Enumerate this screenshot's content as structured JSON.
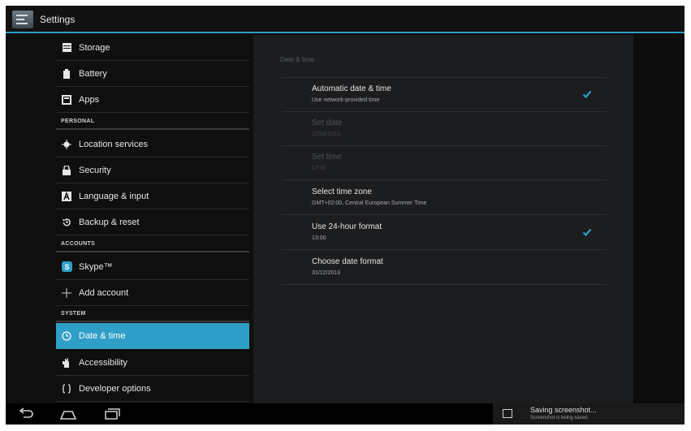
{
  "action_bar": {
    "title": "Settings",
    "icon": "settings-icon"
  },
  "sidebar": {
    "items_top": [
      {
        "label": "Storage",
        "icon": "storage-icon"
      },
      {
        "label": "Battery",
        "icon": "battery-icon"
      },
      {
        "label": "Apps",
        "icon": "apps-icon"
      }
    ],
    "personal_header": "PERSONAL",
    "personal": [
      {
        "label": "Location services",
        "icon": "location-icon"
      },
      {
        "label": "Security",
        "icon": "lock-icon"
      },
      {
        "label": "Language & input",
        "icon": "language-icon"
      },
      {
        "label": "Backup & reset",
        "icon": "backup-icon"
      }
    ],
    "accounts_header": "ACCOUNTS",
    "accounts": [
      {
        "label": "Skype™",
        "icon": "skype-icon"
      },
      {
        "label": "Add account",
        "icon": "plus-icon"
      }
    ],
    "system_header": "SYSTEM",
    "system": [
      {
        "label": "Date & time",
        "icon": "clock-icon",
        "selected": true
      },
      {
        "label": "Accessibility",
        "icon": "accessibility-icon"
      },
      {
        "label": "Developer options",
        "icon": "braces-icon"
      }
    ]
  },
  "panel": {
    "title": "Date & time",
    "rows": [
      {
        "title": "Automatic date & time",
        "subtitle": "Use network-provided time",
        "checked": true,
        "enabled": true
      },
      {
        "title": "Set date",
        "subtitle": "12/06/2013",
        "enabled": false
      },
      {
        "title": "Set time",
        "subtitle": "17:31",
        "enabled": false
      },
      {
        "title": "Select time zone",
        "subtitle": "GMT+02:00, Central European Summer Time",
        "enabled": true
      },
      {
        "title": "Use 24-hour format",
        "subtitle": "13:00",
        "checked": true,
        "enabled": true
      },
      {
        "title": "Choose date format",
        "subtitle": "31/12/2013",
        "enabled": true
      }
    ]
  },
  "notification": {
    "title": "Saving screenshot...",
    "subtitle": "Screenshot is being saved.",
    "icon": "image-icon"
  },
  "navbar": {
    "back": "back-icon",
    "home": "home-icon",
    "recents": "recents-icon"
  },
  "colors": {
    "accent": "#2f9fc7",
    "background": "#0c0c0c",
    "panel": "#1c1d1f"
  }
}
